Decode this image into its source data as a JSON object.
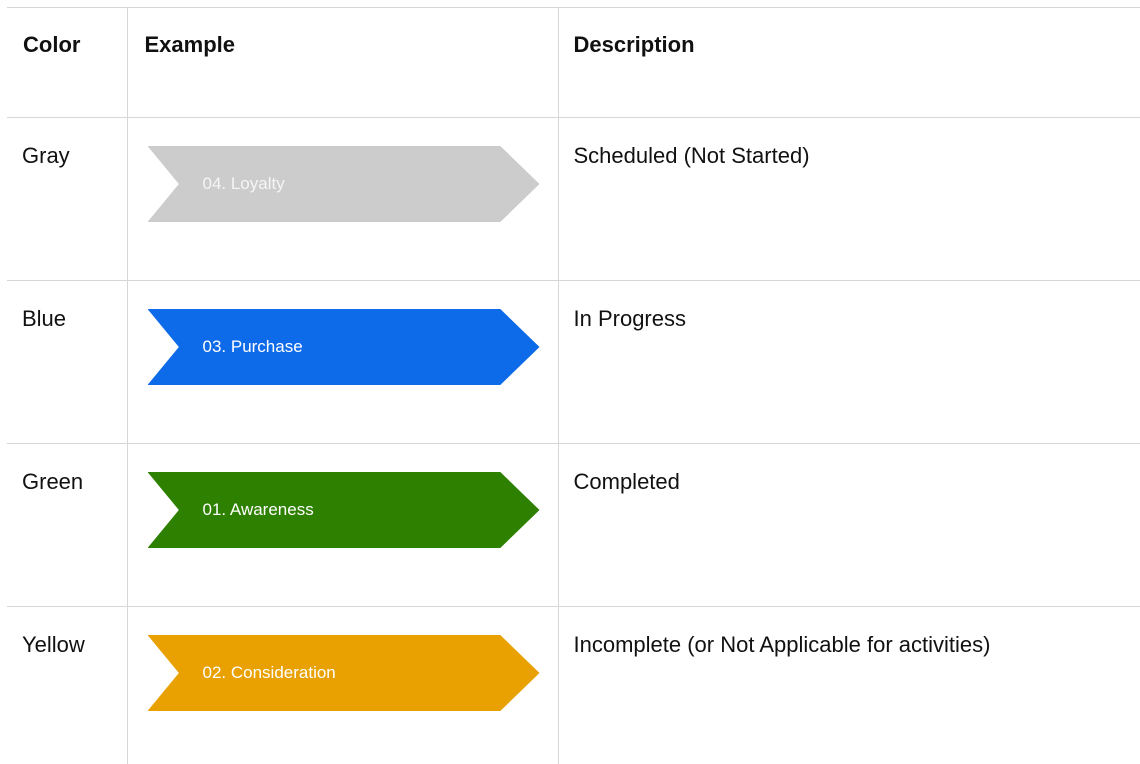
{
  "table": {
    "headers": {
      "color": "Color",
      "example": "Example",
      "description": "Description"
    },
    "rows": [
      {
        "color": "Gray",
        "example_label": "04. Loyalty",
        "description": "Scheduled (Not Started)",
        "fill": "#cccccc"
      },
      {
        "color": "Blue",
        "example_label": "03. Purchase",
        "description": "In Progress",
        "fill": "#0d6ae8"
      },
      {
        "color": "Green",
        "example_label": "01. Awareness",
        "description": "Completed",
        "fill": "#2e8000"
      },
      {
        "color": "Yellow",
        "example_label": "02. Consideration",
        "description": "Incomplete (or Not Applicable for activities)",
        "fill": "#e8a100"
      }
    ]
  }
}
